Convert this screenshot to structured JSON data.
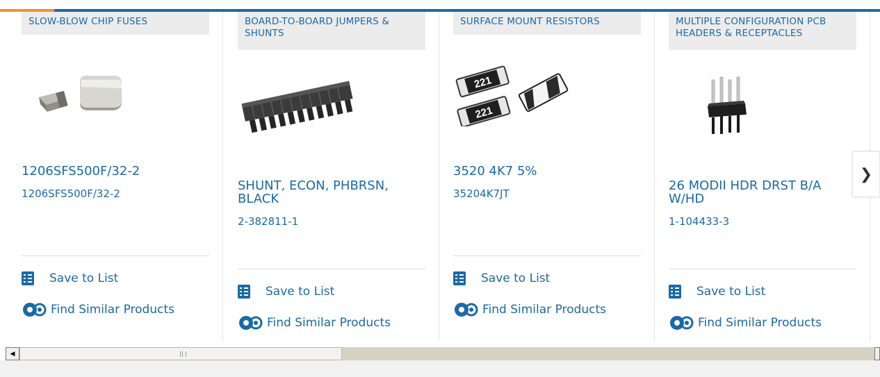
{
  "cards": [
    {
      "category": "SLOW-BLOW CHIP FUSES",
      "title": "1206SFS500F/32-2",
      "part_number": "1206SFS500F/32-2",
      "image": "chip-fuse-photo",
      "save_label": "Save to List",
      "similar_label": "Find Similar Products"
    },
    {
      "category": "BOARD-TO-BOARD JUMPERS & SHUNTS",
      "title": "SHUNT, ECON, PHBRSN, BLACK",
      "part_number": "2-382811-1",
      "image": "jumper-shunt-photo",
      "save_label": "Save to List",
      "similar_label": "Find Similar Products"
    },
    {
      "category": "SURFACE MOUNT RESISTORS",
      "title": "3520 4K7 5%",
      "part_number": "35204K7JT",
      "image": "smd-resistor-photo",
      "resistor_marking": "221",
      "save_label": "Save to List",
      "similar_label": "Find Similar Products"
    },
    {
      "category": "MULTIPLE CONFIGURATION PCB HEADERS & RECEPTACLES",
      "title": "26 MODII HDR DRST B/A W/HD",
      "part_number": "1-104433-3",
      "image": "pcb-header-photo",
      "save_label": "Save to List",
      "similar_label": "Find Similar Products"
    }
  ],
  "icons": {
    "next": "chevron-right-icon",
    "list": "checklist-icon",
    "similar": "gears-icon",
    "scroll_left": "arrow-left-icon"
  },
  "colors": {
    "accent": "#1a6aa5",
    "highlight": "#f0932b",
    "category_bg": "#ececec"
  },
  "scrollbar": {
    "left_arrow": "◀",
    "position_fraction": 0.0
  }
}
